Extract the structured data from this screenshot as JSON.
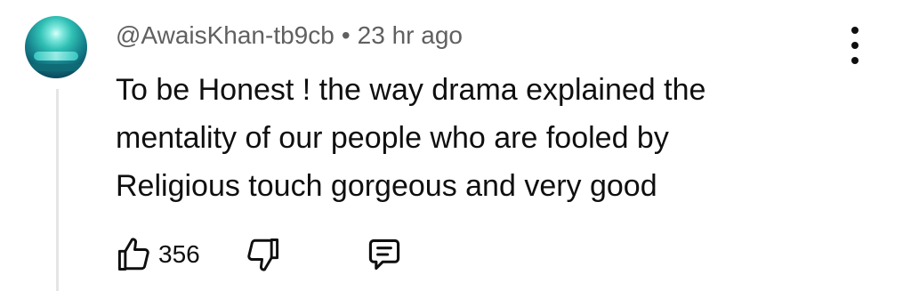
{
  "comment": {
    "author": "@AwaisKhan-tb9cb",
    "separator": "•",
    "time": "23 hr ago",
    "text_lines": [
      "To be Honest ! the way drama explained the",
      "mentality of our people who are fooled by",
      "Religious touch gorgeous and very good"
    ],
    "like_count": "356",
    "icons": {
      "avatar": "user-avatar",
      "menu": "more-vertical-icon",
      "like": "thumbs-up-icon",
      "dislike": "thumbs-down-icon",
      "reply": "reply-comment-icon"
    },
    "colors": {
      "text": "#0f0f0f",
      "meta": "#606060",
      "thread_line": "#e5e5e5"
    }
  }
}
